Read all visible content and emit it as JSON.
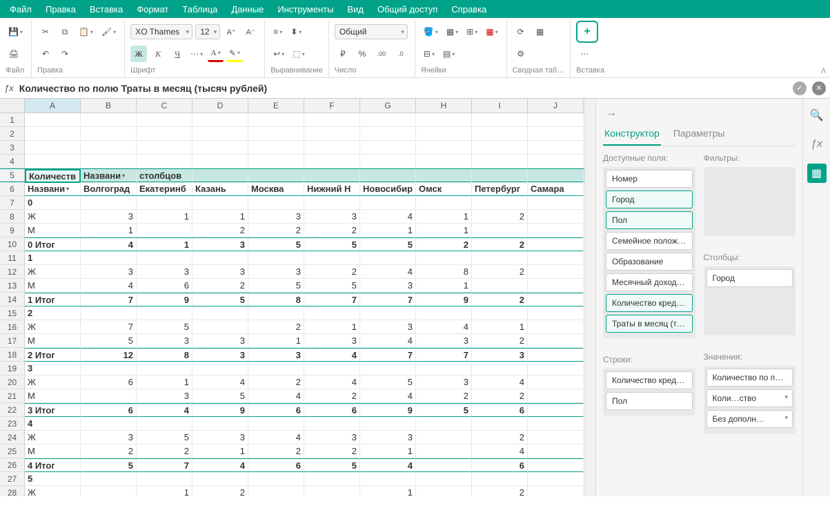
{
  "menu": [
    "Файл",
    "Правка",
    "Вставка",
    "Формат",
    "Таблица",
    "Данные",
    "Инструменты",
    "Вид",
    "Общий доступ",
    "Справка"
  ],
  "toolbar": {
    "groups": {
      "file": "Файл",
      "edit": "Правка",
      "font": "Шрифт",
      "align": "Выравнивание",
      "number": "Число",
      "cells": "Ячейки",
      "pivot": "Сводная таб…",
      "insert": "Вставка"
    },
    "font_name": "XO Thames",
    "font_size": "12",
    "num_format": "Общий"
  },
  "formula": {
    "value": "Количество по полю Траты в месяц (тысяч рублей)"
  },
  "cols": [
    "A",
    "B",
    "C",
    "D",
    "E",
    "F",
    "G",
    "H",
    "I",
    "J"
  ],
  "grid": {
    "pivot_title_row": 5,
    "pivot_title": "Количеств",
    "col_label": "Названи",
    "col_label2": "столбцов",
    "row_label": "Названи",
    "col_headers": [
      "Волгоград",
      "Екатеринб",
      "Казань",
      "Москва",
      "Нижний Н",
      "Новосибир",
      "Омск",
      "Петербург",
      "Самара"
    ],
    "rows": [
      {
        "n": 7,
        "a": "0",
        "bold": true
      },
      {
        "n": 8,
        "a": "    Ж",
        "v": [
          "3",
          "1",
          "1",
          "3",
          "3",
          "4",
          "1",
          "2",
          ""
        ]
      },
      {
        "n": 9,
        "a": "    М",
        "v": [
          "1",
          "",
          "2",
          "2",
          "2",
          "1",
          "1",
          "",
          ""
        ]
      },
      {
        "n": 10,
        "a": "0 Итог",
        "bold": true,
        "tot": true,
        "v": [
          "4",
          "1",
          "3",
          "5",
          "5",
          "5",
          "2",
          "2",
          ""
        ]
      },
      {
        "n": 11,
        "a": "1",
        "bold": true
      },
      {
        "n": 12,
        "a": "    Ж",
        "v": [
          "3",
          "3",
          "3",
          "3",
          "2",
          "4",
          "8",
          "2",
          ""
        ]
      },
      {
        "n": 13,
        "a": "    М",
        "v": [
          "4",
          "6",
          "2",
          "5",
          "5",
          "3",
          "1",
          "",
          ""
        ]
      },
      {
        "n": 14,
        "a": "1 Итог",
        "bold": true,
        "tot": true,
        "v": [
          "7",
          "9",
          "5",
          "8",
          "7",
          "7",
          "9",
          "2",
          ""
        ]
      },
      {
        "n": 15,
        "a": "2",
        "bold": true
      },
      {
        "n": 16,
        "a": "    Ж",
        "v": [
          "7",
          "5",
          "",
          "2",
          "1",
          "3",
          "4",
          "1",
          ""
        ]
      },
      {
        "n": 17,
        "a": "    М",
        "v": [
          "5",
          "3",
          "3",
          "1",
          "3",
          "4",
          "3",
          "2",
          ""
        ]
      },
      {
        "n": 18,
        "a": "2 Итог",
        "bold": true,
        "tot": true,
        "v": [
          "12",
          "8",
          "3",
          "3",
          "4",
          "7",
          "7",
          "3",
          ""
        ]
      },
      {
        "n": 19,
        "a": "3",
        "bold": true
      },
      {
        "n": 20,
        "a": "    Ж",
        "v": [
          "6",
          "1",
          "4",
          "2",
          "4",
          "5",
          "3",
          "4",
          ""
        ]
      },
      {
        "n": 21,
        "a": "    М",
        "v": [
          "",
          "3",
          "5",
          "4",
          "2",
          "4",
          "2",
          "2",
          ""
        ]
      },
      {
        "n": 22,
        "a": "3 Итог",
        "bold": true,
        "tot": true,
        "v": [
          "6",
          "4",
          "9",
          "6",
          "6",
          "9",
          "5",
          "6",
          ""
        ]
      },
      {
        "n": 23,
        "a": "4",
        "bold": true
      },
      {
        "n": 24,
        "a": "    Ж",
        "v": [
          "3",
          "5",
          "3",
          "4",
          "3",
          "3",
          "",
          "2",
          ""
        ]
      },
      {
        "n": 25,
        "a": "    М",
        "v": [
          "2",
          "2",
          "1",
          "2",
          "2",
          "1",
          "",
          "4",
          ""
        ]
      },
      {
        "n": 26,
        "a": "4 Итог",
        "bold": true,
        "tot": true,
        "v": [
          "5",
          "7",
          "4",
          "6",
          "5",
          "4",
          "",
          "6",
          ""
        ]
      },
      {
        "n": 27,
        "a": "5",
        "bold": true
      },
      {
        "n": 28,
        "a": "    Ж",
        "v": [
          "",
          "1",
          "2",
          "",
          "",
          "1",
          "",
          "2",
          ""
        ]
      }
    ]
  },
  "panel": {
    "tabs": [
      "Конструктор",
      "Параметры"
    ],
    "labels": {
      "fields": "Доступные поля:",
      "filters": "Фильтры:",
      "cols": "Столбцы:",
      "rows": "Строки:",
      "vals": "Значения:"
    },
    "fields": [
      {
        "t": "Номер",
        "sel": false
      },
      {
        "t": "Город",
        "sel": true
      },
      {
        "t": "Пол",
        "sel": true
      },
      {
        "t": "Семейное полож…",
        "sel": false
      },
      {
        "t": "Образование",
        "sel": false
      },
      {
        "t": "Месячный доход…",
        "sel": false
      },
      {
        "t": "Количество кред…",
        "sel": true
      },
      {
        "t": "Траты в месяц (т…",
        "sel": true
      }
    ],
    "cols_z": [
      "Город"
    ],
    "rows_z": [
      "Количество кред…",
      "Пол"
    ],
    "vals_z": [
      {
        "t": "Количество по п…"
      },
      {
        "t": "Коли…ство",
        "dd": true
      },
      {
        "t": "Без дополн…",
        "dd": true
      }
    ]
  }
}
